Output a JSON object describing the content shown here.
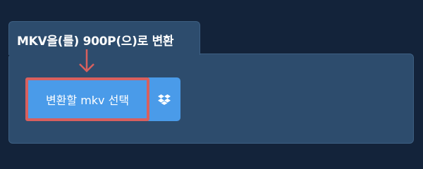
{
  "tab": {
    "title": "MKV을(를) 900P(으)로 변환"
  },
  "buttons": {
    "select_label": "변환할 mkv 선택",
    "dropbox_icon": "dropbox-icon"
  },
  "colors": {
    "background": "#13233a",
    "panel": "#2d4c6d",
    "button": "#4a9be9",
    "highlight": "#d8605e",
    "text": "#ffffff"
  }
}
